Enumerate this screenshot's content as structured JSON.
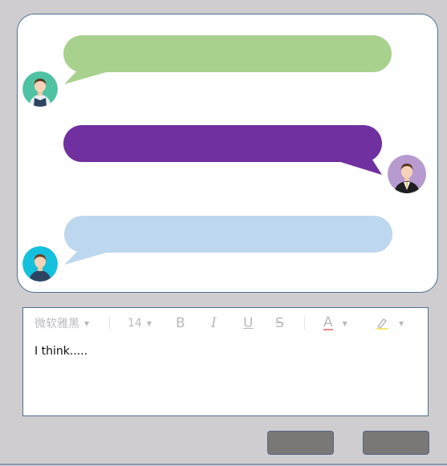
{
  "colors": {
    "background": "#cfcdcf",
    "panel_border": "#4f6f93",
    "bubble_1": "#a8d18e",
    "bubble_2": "#7030a0",
    "bubble_3": "#bdd7ee",
    "button": "#7a7777"
  },
  "messages": [
    {
      "side": "left",
      "avatar": "avatar-green-male",
      "color": "#a8d18e",
      "text": ""
    },
    {
      "side": "right",
      "avatar": "avatar-purple-suit-male",
      "color": "#7030a0",
      "text": ""
    },
    {
      "side": "left",
      "avatar": "avatar-cyan-male",
      "color": "#bdd7ee",
      "text": ""
    }
  ],
  "editor": {
    "toolbar": {
      "font_family": "微软雅黑",
      "font_size": "14",
      "bold_label": "B",
      "italic_label": "I",
      "underline_label": "U",
      "strike_label": "S",
      "font_color_label": "A",
      "icons": [
        "bold-icon",
        "italic-icon",
        "underline-icon",
        "strikethrough-icon",
        "font-color-icon",
        "highlight-icon"
      ]
    },
    "content": "I think....."
  },
  "buttons": [
    {
      "label": ""
    },
    {
      "label": ""
    }
  ]
}
